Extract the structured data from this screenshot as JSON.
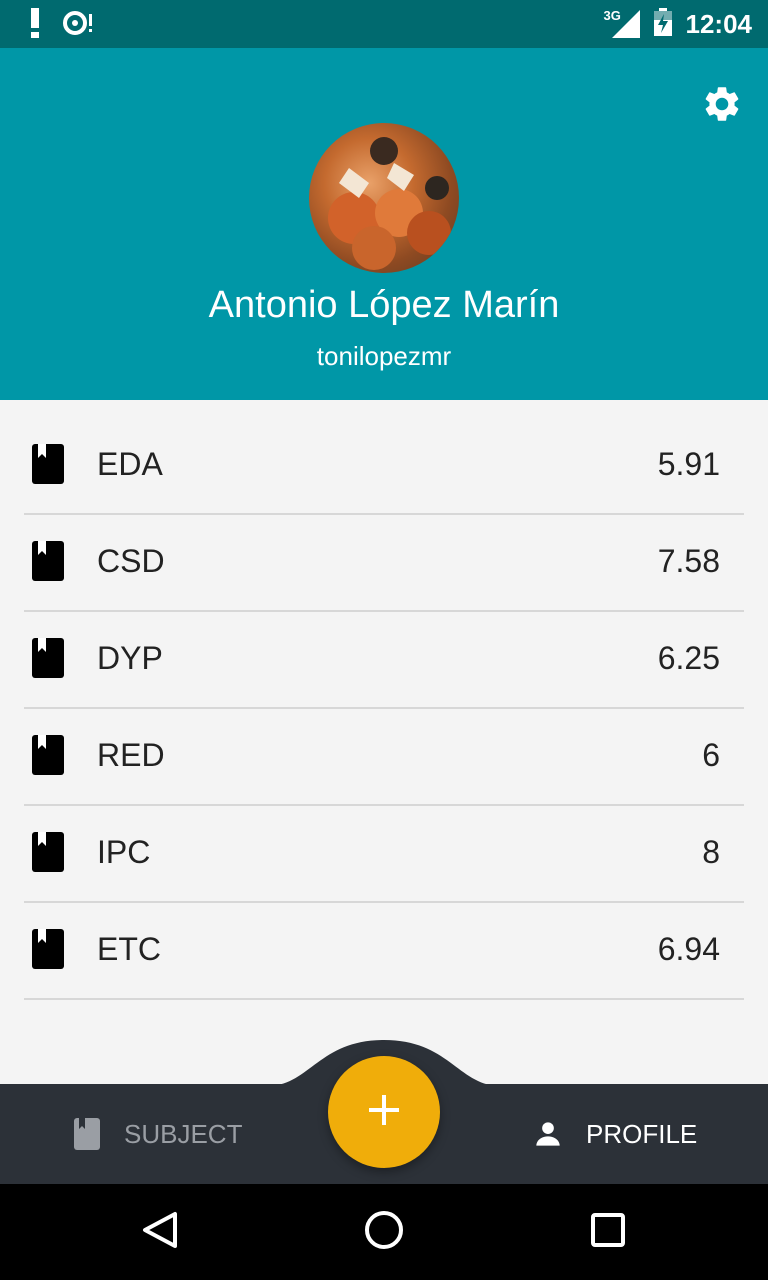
{
  "status_bar": {
    "time": "12:04",
    "network": "3G",
    "icons": [
      "alert-icon",
      "sync-icon",
      "signal-icon",
      "battery-icon"
    ]
  },
  "header": {
    "background": "#0097a7",
    "name": "Antonio López Marín",
    "username": "tonilopezmr",
    "settings_icon": "gear-icon"
  },
  "subjects": [
    {
      "name": "EDA",
      "grade": "5.91"
    },
    {
      "name": "CSD",
      "grade": "7.58"
    },
    {
      "name": "DYP",
      "grade": "6.25"
    },
    {
      "name": "RED",
      "grade": "6"
    },
    {
      "name": "IPC",
      "grade": "8"
    },
    {
      "name": "ETC",
      "grade": "6.94"
    }
  ],
  "bottom_nav": {
    "subject_label": "SUBJECT",
    "profile_label": "PROFILE",
    "active": "profile",
    "background": "#2c3138"
  },
  "fab": {
    "icon": "plus-icon",
    "color": "#f0ad0a"
  },
  "system_nav": {
    "icons": [
      "back-icon",
      "home-icon",
      "recents-icon"
    ]
  }
}
